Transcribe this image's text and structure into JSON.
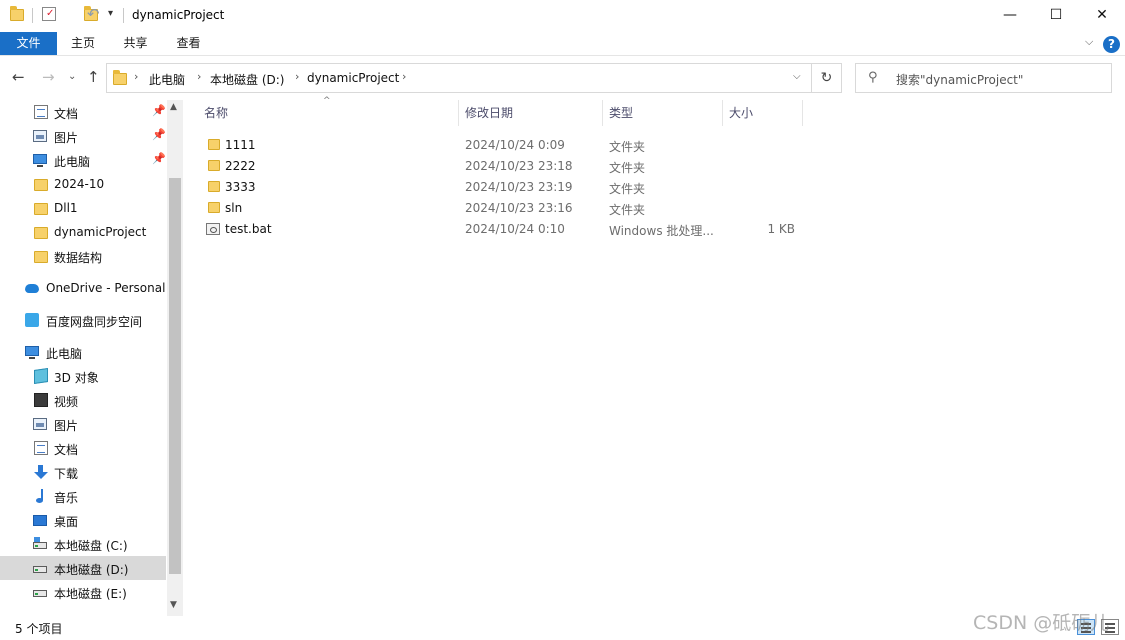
{
  "window": {
    "title": "dynamicProject",
    "minimize_glyph": "—",
    "maximize_glyph": "☐",
    "close_glyph": "✕"
  },
  "ribbon": {
    "tabs": [
      "文件",
      "主页",
      "共享",
      "查看"
    ],
    "help_glyph": "?"
  },
  "address": {
    "segments": [
      "此电脑",
      "本地磁盘 (D:)",
      "dynamicProject"
    ]
  },
  "search": {
    "placeholder": "搜索\"dynamicProject\""
  },
  "sidebar": {
    "quick_access": [
      {
        "label": "文档",
        "icon": "document-icon",
        "pinned": true
      },
      {
        "label": "图片",
        "icon": "pictures-icon",
        "pinned": true
      },
      {
        "label": "此电脑",
        "icon": "computer-icon",
        "pinned": true
      },
      {
        "label": "2024-10",
        "icon": "folder-icon"
      },
      {
        "label": "Dll1",
        "icon": "folder-icon"
      },
      {
        "label": "dynamicProject",
        "icon": "folder-icon"
      },
      {
        "label": "数据结构",
        "icon": "folder-icon"
      }
    ],
    "onedrive": "OneDrive - Personal",
    "baidu": "百度网盘同步空间",
    "this_pc": "此电脑",
    "pc_items": [
      {
        "label": "3D 对象",
        "icon": "3d-objects-icon"
      },
      {
        "label": "视频",
        "icon": "video-icon"
      },
      {
        "label": "图片",
        "icon": "pictures-icon"
      },
      {
        "label": "文档",
        "icon": "document-icon"
      },
      {
        "label": "下载",
        "icon": "download-icon"
      },
      {
        "label": "音乐",
        "icon": "music-icon"
      },
      {
        "label": "桌面",
        "icon": "desktop-icon"
      },
      {
        "label": "本地磁盘 (C:)",
        "icon": "drive-c-icon"
      },
      {
        "label": "本地磁盘 (D:)",
        "icon": "drive-icon",
        "selected": true
      },
      {
        "label": "本地磁盘 (E:)",
        "icon": "drive-icon"
      }
    ]
  },
  "columns": {
    "name": "名称",
    "date": "修改日期",
    "type": "类型",
    "size": "大小"
  },
  "files": [
    {
      "name": "1111",
      "date": "2024/10/24 0:09",
      "type": "文件夹",
      "size": "",
      "icon": "folder-icon"
    },
    {
      "name": "2222",
      "date": "2024/10/23 23:18",
      "type": "文件夹",
      "size": "",
      "icon": "folder-icon"
    },
    {
      "name": "3333",
      "date": "2024/10/23 23:19",
      "type": "文件夹",
      "size": "",
      "icon": "folder-icon"
    },
    {
      "name": "sln",
      "date": "2024/10/23 23:16",
      "type": "文件夹",
      "size": "",
      "icon": "folder-icon"
    },
    {
      "name": "test.bat",
      "date": "2024/10/24 0:10",
      "type": "Windows 批处理...",
      "size": "1 KB",
      "icon": "batch-file-icon"
    }
  ],
  "status": {
    "item_count": "5 个项目"
  },
  "watermark": "CSDN @砥砺儿"
}
